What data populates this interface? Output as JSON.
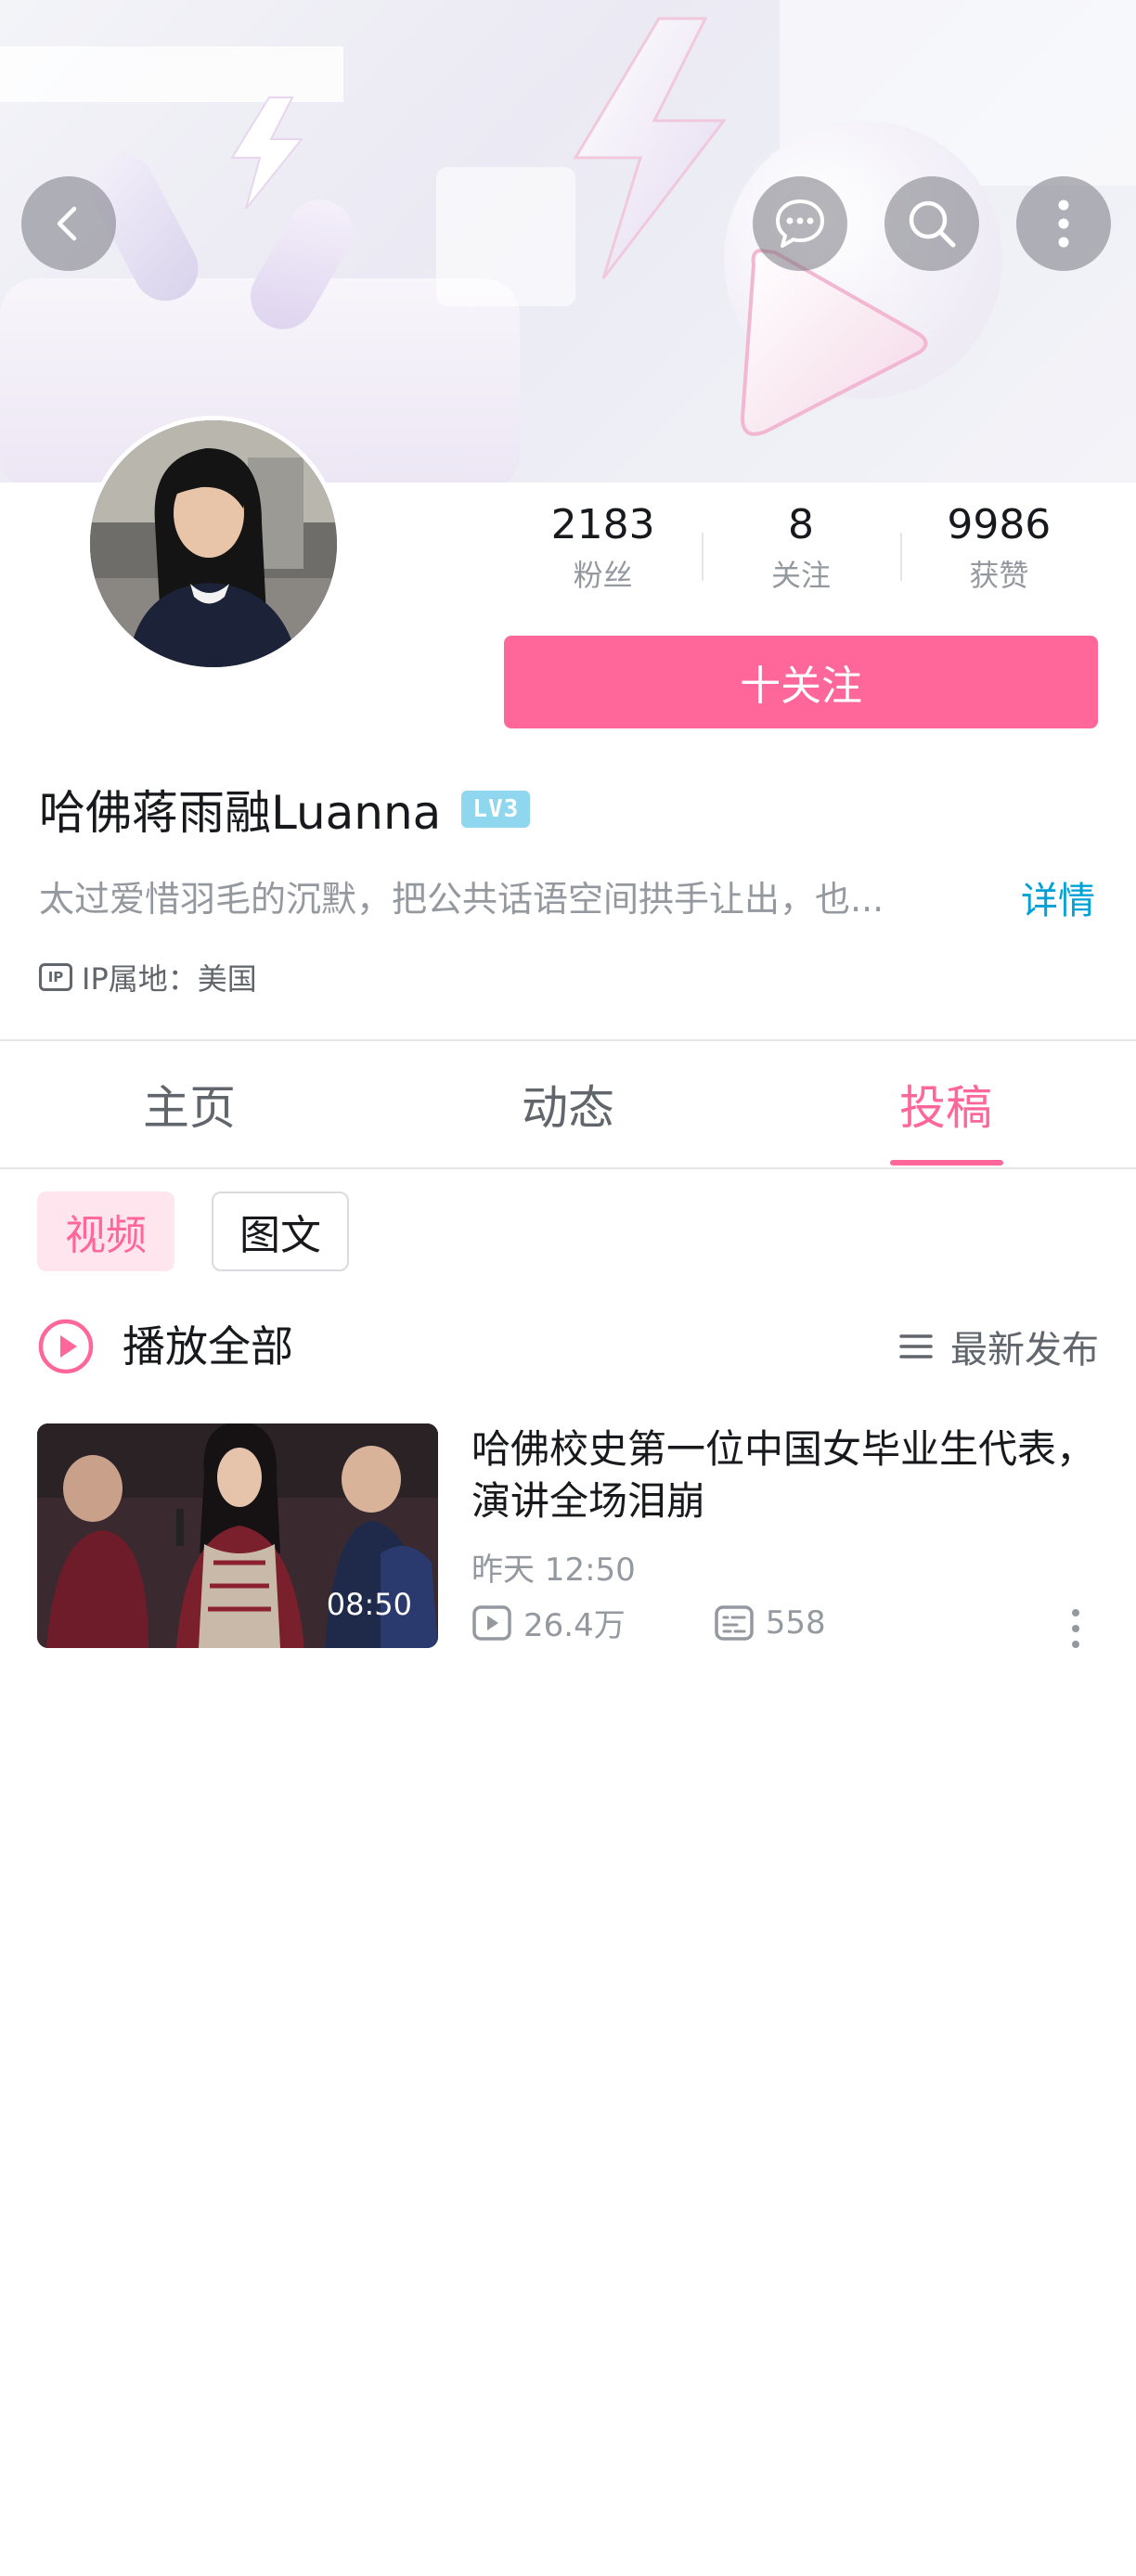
{
  "header": {
    "back_icon": "chevron-left-icon",
    "actions": [
      "message-icon",
      "search-icon",
      "more-vertical-icon"
    ]
  },
  "profile": {
    "stats": [
      {
        "value": "2183",
        "label": "粉丝"
      },
      {
        "value": "8",
        "label": "关注"
      },
      {
        "value": "9986",
        "label": "获赞"
      }
    ],
    "follow_label": "十关注",
    "username": "哈佛蒋雨融Luanna",
    "level": "LV3",
    "bio": "太过爱惜羽毛的沉默，把公共话语空间拱手让出，也...",
    "bio_more": "详情",
    "ip_badge": "IP",
    "ip_location": "IP属地：美国"
  },
  "tabs": [
    "主页",
    "动态",
    "投稿"
  ],
  "active_tab": "投稿",
  "filters": {
    "video": "视频",
    "article": "图文"
  },
  "playall": {
    "label": "播放全部",
    "sort_label": "最新发布"
  },
  "videos": [
    {
      "title": "哈佛校史第一位中国女毕业生代表，演讲全场泪崩",
      "duration": "08:50",
      "time": "昨天 12:50",
      "views": "26.4万",
      "danmaku": "558"
    }
  ],
  "colors": {
    "accent": "#ff6699",
    "link": "#00a1d6",
    "muted": "#9499a0",
    "level_badge": "#8fd6ef"
  }
}
